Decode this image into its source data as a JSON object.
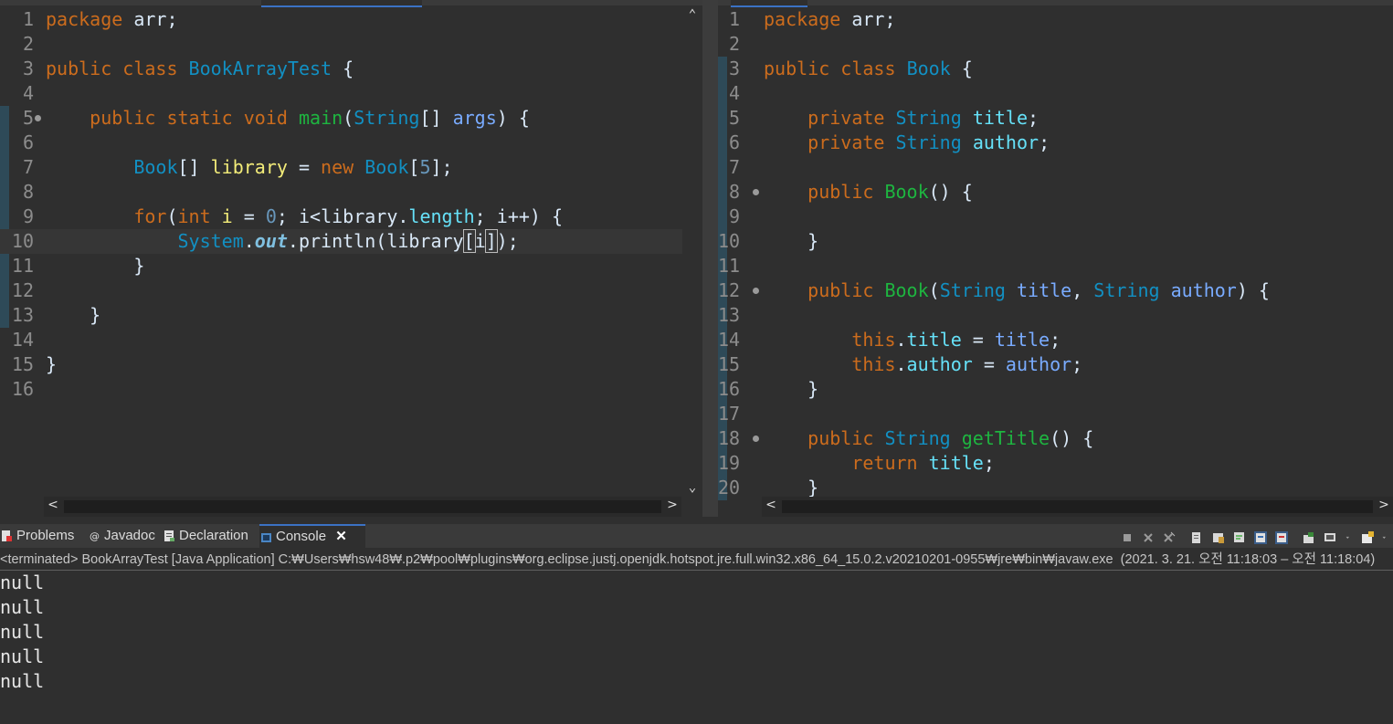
{
  "left_editor": {
    "lines": [
      {
        "n": "1"
      },
      {
        "n": "2"
      },
      {
        "n": "3"
      },
      {
        "n": "4"
      },
      {
        "n": "5"
      },
      {
        "n": "6"
      },
      {
        "n": "7"
      },
      {
        "n": "8"
      },
      {
        "n": "9"
      },
      {
        "n": "10"
      },
      {
        "n": "11"
      },
      {
        "n": "12"
      },
      {
        "n": "13"
      },
      {
        "n": "14"
      },
      {
        "n": "15"
      },
      {
        "n": "16"
      }
    ],
    "tokens": {
      "package": "package",
      "arr": " arr;",
      "public": "public",
      "class": " class ",
      "BookArrayTest": "BookArrayTest",
      "brace": " {",
      "static": "static",
      "void": "void",
      "main": "main",
      "String": "String",
      "args": "args",
      "Book": "Book",
      "library": "library",
      "new": "new",
      "five": "5",
      "for": "for",
      "int": "int",
      "i": "i",
      "zero": "0",
      "length": "length",
      "System": "System",
      "out": "out",
      "println": "println"
    }
  },
  "right_editor": {
    "lines": [
      {
        "n": "1"
      },
      {
        "n": "2"
      },
      {
        "n": "3"
      },
      {
        "n": "4"
      },
      {
        "n": "5"
      },
      {
        "n": "6"
      },
      {
        "n": "7"
      },
      {
        "n": "8"
      },
      {
        "n": "9"
      },
      {
        "n": "10"
      },
      {
        "n": "11"
      },
      {
        "n": "12"
      },
      {
        "n": "13"
      },
      {
        "n": "14"
      },
      {
        "n": "15"
      },
      {
        "n": "16"
      },
      {
        "n": "17"
      },
      {
        "n": "18"
      },
      {
        "n": "19"
      },
      {
        "n": "20"
      }
    ]
  },
  "console": {
    "tabs": [
      {
        "label": "Problems"
      },
      {
        "label": "Javadoc"
      },
      {
        "label": "Declaration"
      },
      {
        "label": "Console"
      }
    ],
    "close_glyph": "✕",
    "status": "<terminated> BookArrayTest [Java Application] C:₩Users₩hsw48₩.p2₩pool₩plugins₩org.eclipse.justj.openjdk.hotspot.jre.full.win32.x86_64_15.0.2.v20210201-0955₩jre₩bin₩javaw.exe  (2021. 3. 21. 오전 11:18:03 – 오전 11:18:04)",
    "output": [
      "null",
      "null",
      "null",
      "null",
      "null"
    ]
  },
  "icons": {
    "up": "⌃",
    "down": "⌄",
    "left": "<",
    "right": ">"
  }
}
